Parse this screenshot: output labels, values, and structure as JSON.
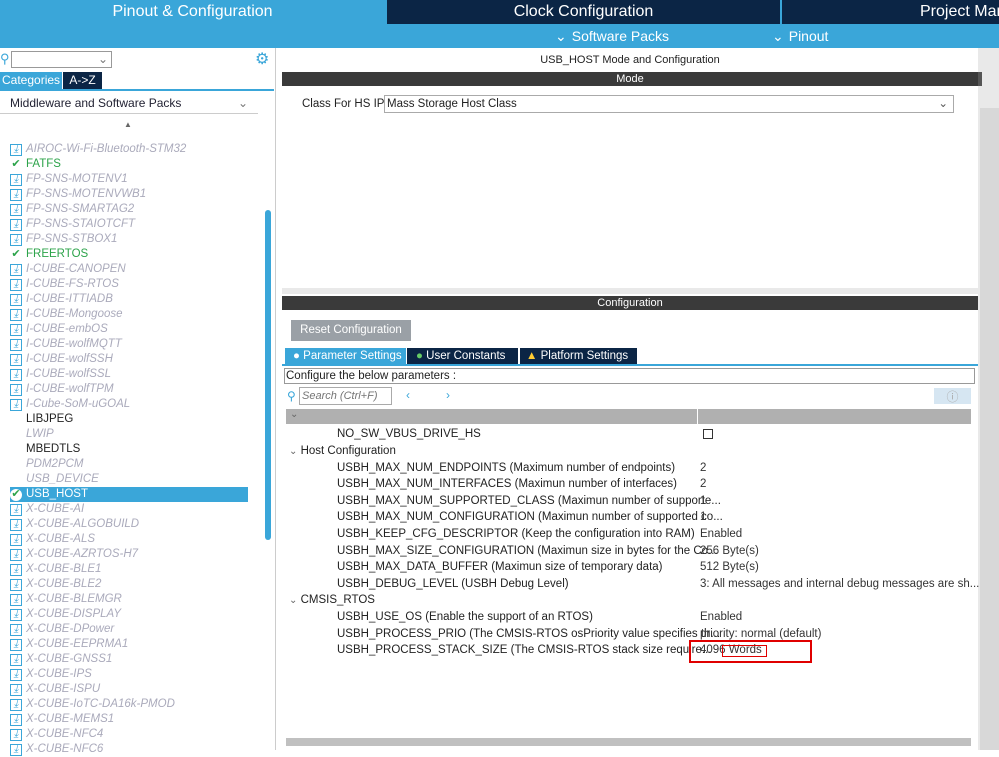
{
  "header": {
    "tabs": [
      "Pinout & Configuration",
      "Clock Configuration",
      "Project Manager"
    ],
    "sub": [
      "Software Packs",
      "Pinout"
    ]
  },
  "sidebar": {
    "view_tabs": [
      "Categories",
      "A->Z"
    ],
    "category": "Middleware and Software Packs",
    "items": [
      {
        "label": "AIROC-Wi-Fi-Bluetooth-STM32",
        "state": "dl"
      },
      {
        "label": "FATFS",
        "state": "ok"
      },
      {
        "label": "FP-SNS-MOTENV1",
        "state": "dl"
      },
      {
        "label": "FP-SNS-MOTENVWB1",
        "state": "dl"
      },
      {
        "label": "FP-SNS-SMARTAG2",
        "state": "dl"
      },
      {
        "label": "FP-SNS-STAIOTCFT",
        "state": "dl"
      },
      {
        "label": "FP-SNS-STBOX1",
        "state": "dl"
      },
      {
        "label": "FREERTOS",
        "state": "ok"
      },
      {
        "label": "I-CUBE-CANOPEN",
        "state": "dl"
      },
      {
        "label": "I-CUBE-FS-RTOS",
        "state": "dl"
      },
      {
        "label": "I-CUBE-ITTIADB",
        "state": "dl"
      },
      {
        "label": "I-CUBE-Mongoose",
        "state": "dl"
      },
      {
        "label": "I-CUBE-embOS",
        "state": "dl"
      },
      {
        "label": "I-CUBE-wolfMQTT",
        "state": "dl"
      },
      {
        "label": "I-CUBE-wolfSSH",
        "state": "dl"
      },
      {
        "label": "I-CUBE-wolfSSL",
        "state": "dl"
      },
      {
        "label": "I-CUBE-wolfTPM",
        "state": "dl"
      },
      {
        "label": "I-Cube-SoM-uGOAL",
        "state": "dl"
      },
      {
        "label": "LIBJPEG",
        "state": "plain"
      },
      {
        "label": "LWIP",
        "state": "grey"
      },
      {
        "label": "MBEDTLS",
        "state": "plain"
      },
      {
        "label": "PDM2PCM",
        "state": "grey"
      },
      {
        "label": "USB_DEVICE",
        "state": "grey"
      },
      {
        "label": "USB_HOST",
        "state": "sel"
      },
      {
        "label": "X-CUBE-AI",
        "state": "dl"
      },
      {
        "label": "X-CUBE-ALGOBUILD",
        "state": "dl"
      },
      {
        "label": "X-CUBE-ALS",
        "state": "dl"
      },
      {
        "label": "X-CUBE-AZRTOS-H7",
        "state": "dl"
      },
      {
        "label": "X-CUBE-BLE1",
        "state": "dl"
      },
      {
        "label": "X-CUBE-BLE2",
        "state": "dl"
      },
      {
        "label": "X-CUBE-BLEMGR",
        "state": "dl"
      },
      {
        "label": "X-CUBE-DISPLAY",
        "state": "dl"
      },
      {
        "label": "X-CUBE-DPower",
        "state": "dl"
      },
      {
        "label": "X-CUBE-EEPRMA1",
        "state": "dl"
      },
      {
        "label": "X-CUBE-GNSS1",
        "state": "dl"
      },
      {
        "label": "X-CUBE-IPS",
        "state": "dl"
      },
      {
        "label": "X-CUBE-ISPU",
        "state": "dl"
      },
      {
        "label": "X-CUBE-IoTC-DA16k-PMOD",
        "state": "dl"
      },
      {
        "label": "X-CUBE-MEMS1",
        "state": "dl"
      },
      {
        "label": "X-CUBE-NFC4",
        "state": "dl"
      },
      {
        "label": "X-CUBE-NFC6",
        "state": "dl"
      }
    ]
  },
  "main": {
    "title": "USB_HOST Mode and Configuration",
    "mode_header": "Mode",
    "class_label": "Class For HS IP",
    "class_value": "Mass Storage Host Class",
    "config_header": "Configuration",
    "reset": "Reset Configuration",
    "tabs": [
      "Parameter Settings",
      "User Constants",
      "Platform Settings"
    ],
    "configure_text": "Configure the below parameters :",
    "search_placeholder": "Search (Ctrl+F)",
    "top_param": "NO_SW_VBUS_DRIVE_HS",
    "groups": [
      {
        "name": "Host Configuration",
        "params": [
          [
            "USBH_MAX_NUM_ENDPOINTS (Maximum number of endpoints)",
            "2"
          ],
          [
            "USBH_MAX_NUM_INTERFACES (Maximun number of interfaces)",
            "2"
          ],
          [
            "USBH_MAX_NUM_SUPPORTED_CLASS (Maximun number of supporte...",
            "1"
          ],
          [
            "USBH_MAX_NUM_CONFIGURATION (Maximun number of supported co...",
            "1"
          ],
          [
            "USBH_KEEP_CFG_DESCRIPTOR (Keep the configuration into RAM)",
            "Enabled"
          ],
          [
            "USBH_MAX_SIZE_CONFIGURATION (Maximun size in bytes for the Co...",
            "256 Byte(s)"
          ],
          [
            "USBH_MAX_DATA_BUFFER (Maximun size of temporary data)",
            "512 Byte(s)"
          ],
          [
            "USBH_DEBUG_LEVEL (USBH Debug Level)",
            "3: All messages and internal debug messages are sh..."
          ]
        ]
      },
      {
        "name": "CMSIS_RTOS",
        "params": [
          [
            "USBH_USE_OS (Enable the support of an RTOS)",
            "Enabled"
          ],
          [
            "USBH_PROCESS_PRIO (The CMSIS-RTOS osPriority value specifies th...",
            "priority: normal (default)"
          ],
          [
            "USBH_PROCESS_STACK_SIZE (The CMSIS-RTOS stack size require...",
            "4096 Words"
          ]
        ]
      }
    ]
  },
  "colors": {
    "accent": "#3aa6d9",
    "dark": "#0b2545",
    "highlight": "#e00000"
  }
}
